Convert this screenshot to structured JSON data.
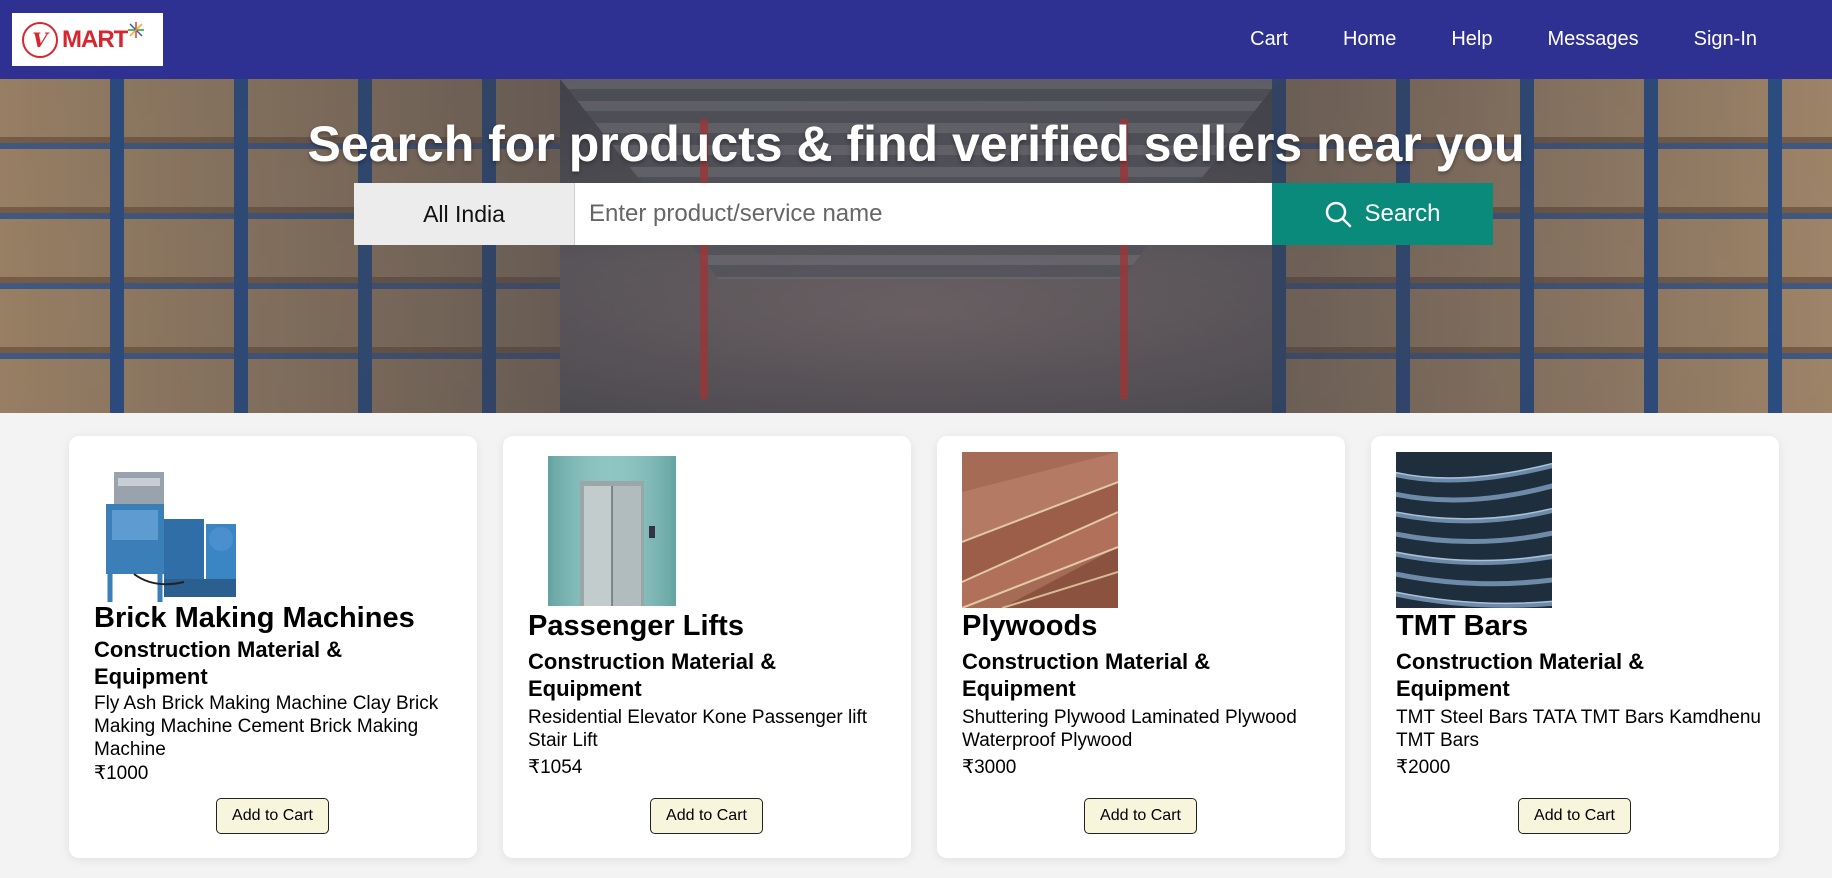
{
  "header": {
    "logo_text": "MART",
    "nav": [
      "Cart",
      "Home",
      "Help",
      "Messages",
      "Sign-In"
    ]
  },
  "hero": {
    "title": "Search for products & find verified sellers near you",
    "region": "All India",
    "search_placeholder": "Enter product/service name",
    "search_label": "Search"
  },
  "products": [
    {
      "name": "Brick Making Machines",
      "category": "Construction Material & Equipment",
      "description": "Fly Ash Brick Making Machine Clay Brick Making Machine Cement Brick Making Machine",
      "price": "₹1000",
      "button": "Add to Cart"
    },
    {
      "name": "Passenger Lifts",
      "category": "Construction Material & Equipment",
      "description": "Residential Elevator Kone Passenger lift Stair Lift",
      "price": "₹1054",
      "button": "Add to Cart"
    },
    {
      "name": "Plywoods",
      "category": "Construction Material & Equipment",
      "description": "Shuttering Plywood Laminated Plywood Waterproof Plywood",
      "price": "₹3000",
      "button": "Add to Cart"
    },
    {
      "name": "TMT Bars",
      "category": "Construction Material & Equipment",
      "description": "TMT Steel Bars TATA TMT Bars Kamdhenu TMT Bars",
      "price": "₹2000",
      "button": "Add to Cart"
    }
  ],
  "colors": {
    "header_bg": "#2e3192",
    "search_button": "#0a8a7b",
    "brand_red": "#d7262e",
    "add_to_cart_bg": "#f7f5dc"
  }
}
